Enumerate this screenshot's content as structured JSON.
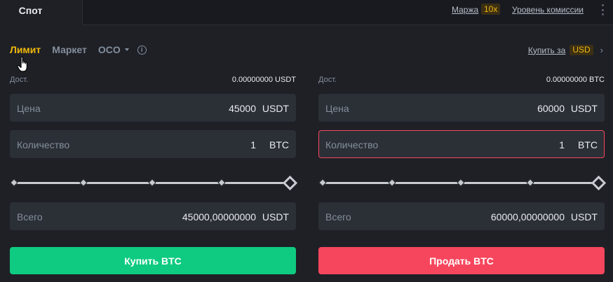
{
  "topbar": {
    "spot_tab": "Спот",
    "margin_label": "Маржа",
    "leverage_badge": "10x",
    "fee_level_label": "Уровень комиссии"
  },
  "order_tabs": {
    "limit": "Лимит",
    "market": "Маркет",
    "oco": "OCO",
    "active": "limit"
  },
  "buy_for": {
    "label": "Купить за",
    "currency": "USD"
  },
  "buy_panel": {
    "available_label": "Дост.",
    "available_value": "0.00000000 USDT",
    "price": {
      "label": "Цена",
      "value": "45000",
      "unit": "USDT"
    },
    "quantity": {
      "label": "Количество",
      "value": "1",
      "unit": "BTC"
    },
    "total": {
      "label": "Всего",
      "value": "45000,00000000",
      "unit": "USDT"
    },
    "slider_percent": 100,
    "button_label": "Купить BTC"
  },
  "sell_panel": {
    "available_label": "Дост.",
    "available_value": "0.00000000 BTC",
    "price": {
      "label": "Цена",
      "value": "60000",
      "unit": "USDT"
    },
    "quantity": {
      "label": "Количество",
      "value": "1",
      "unit": "BTC"
    },
    "total": {
      "label": "Всего",
      "value": "60000,00000000",
      "unit": "USDT"
    },
    "slider_percent": 100,
    "button_label": "Продать BTC"
  },
  "colors": {
    "accent": "#f0b90b",
    "buy": "#0ecb81",
    "sell": "#f6465d",
    "background": "#1e2026",
    "input_bg": "#2b2f36"
  }
}
